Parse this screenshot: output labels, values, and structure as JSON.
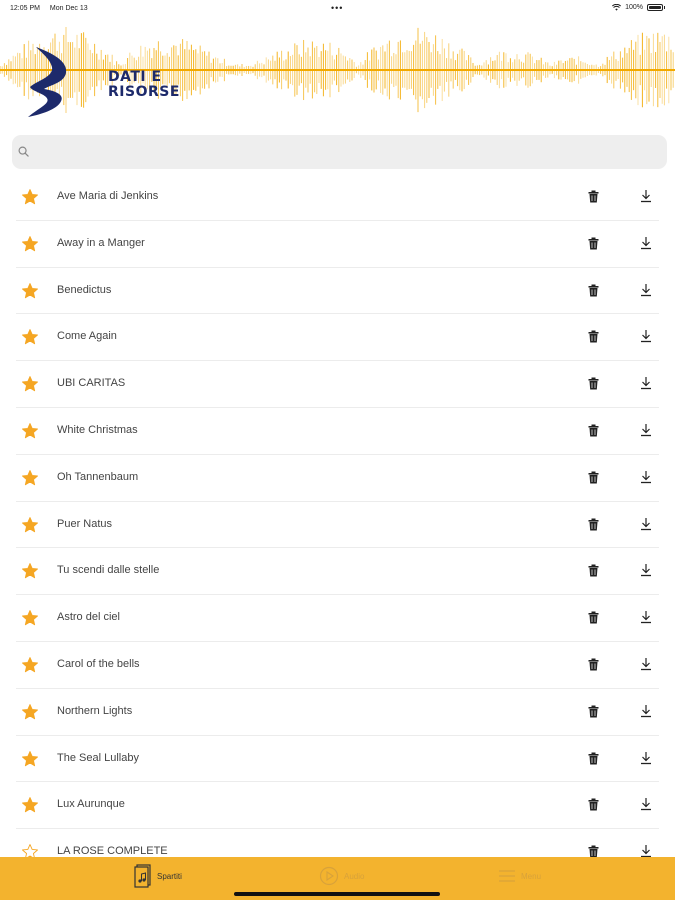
{
  "status_bar": {
    "time": "12:05 PM",
    "date": "Mon Dec 13",
    "dots": "•••",
    "battery": "100%"
  },
  "header": {
    "logo_line1": "DATI E",
    "logo_line2": "RISORSE",
    "wave_color": "#f2a900",
    "logo_color": "#1d2a6b"
  },
  "search": {
    "placeholder": "",
    "value": ""
  },
  "songs": [
    {
      "title": "Ave Maria di Jenkins",
      "favorite": true
    },
    {
      "title": "Away in a Manger",
      "favorite": true
    },
    {
      "title": "Benedictus",
      "favorite": true
    },
    {
      "title": "Come Again",
      "favorite": true
    },
    {
      "title": "UBI CARITAS",
      "favorite": true
    },
    {
      "title": "White Christmas",
      "favorite": true
    },
    {
      "title": "Oh Tannenbaum",
      "favorite": true
    },
    {
      "title": "Puer Natus",
      "favorite": true
    },
    {
      "title": "Tu scendi dalle stelle",
      "favorite": true
    },
    {
      "title": "Astro del ciel",
      "favorite": true
    },
    {
      "title": "Carol of the bells",
      "favorite": true
    },
    {
      "title": "Northern Lights",
      "favorite": true
    },
    {
      "title": "The Seal Lullaby",
      "favorite": true
    },
    {
      "title": "Lux Aurunque",
      "favorite": true
    },
    {
      "title": "LA ROSE COMPLETE",
      "favorite": false
    }
  ],
  "icons": {
    "star": "star-icon",
    "trash": "trash-icon",
    "download": "download-icon"
  },
  "colors": {
    "accent": "#f3b32e",
    "star": "#f5a623"
  },
  "tabbar": {
    "tabs": [
      {
        "label": "Spartiti",
        "icon": "sheet-music-icon",
        "active": true
      },
      {
        "label": "Audio",
        "icon": "play-circle-icon",
        "active": false
      },
      {
        "label": "Menu",
        "icon": "menu-icon",
        "active": false
      }
    ]
  }
}
